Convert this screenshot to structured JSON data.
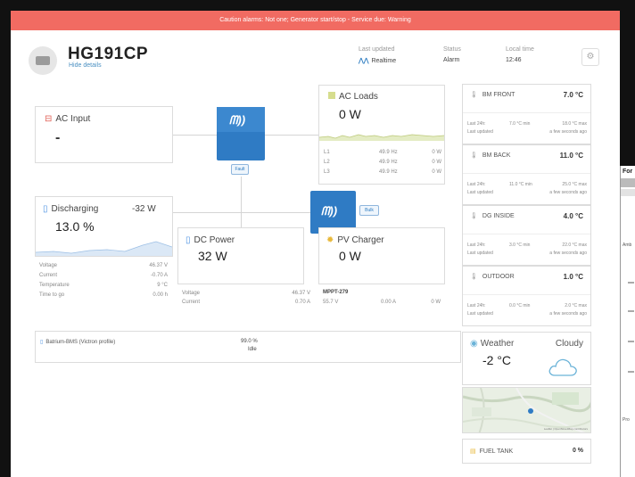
{
  "banner": {
    "text": "Caution alarms: Not one; Generator start/stop - Service due: Warning"
  },
  "header": {
    "device_name": "HG191CP",
    "hide_details": "Hide details",
    "last_updated_label": "Last updated",
    "last_updated_value": "Realtime",
    "status_label": "Status",
    "status_value": "Alarm",
    "local_time_label": "Local time",
    "local_time_value": "12:46"
  },
  "ac_input": {
    "title": "AC Input",
    "value": "-"
  },
  "inverter": {
    "badge": "Fault"
  },
  "ac_loads": {
    "title": "AC Loads",
    "value": "0 W",
    "phases": [
      {
        "label": "L1",
        "freq": "49.9 Hz",
        "power": "0 W"
      },
      {
        "label": "L2",
        "freq": "49.9 Hz",
        "power": "0 W"
      },
      {
        "label": "L3",
        "freq": "49.9 Hz",
        "power": "0 W"
      }
    ]
  },
  "battery": {
    "title": "Discharging",
    "current": "-32 W",
    "value": "13.0 %",
    "details": [
      {
        "label": "Voltage",
        "value": "46.37 V"
      },
      {
        "label": "Current",
        "value": "-0.70 A"
      },
      {
        "label": "Temperature",
        "value": "9 °C"
      },
      {
        "label": "Time to go",
        "value": "0.00 h"
      }
    ]
  },
  "dc_power": {
    "title": "DC Power",
    "value": "32 W",
    "details": [
      {
        "label": "Voltage",
        "value": "46.37 V"
      },
      {
        "label": "Current",
        "value": "0.70 A"
      }
    ]
  },
  "mppt": {
    "badge": "Bulk"
  },
  "pv_charger": {
    "title": "PV Charger",
    "value": "0 W",
    "model": "MPPT-279",
    "voltage": "55.7 V",
    "current": "0.00 A",
    "power": "0 W"
  },
  "bms": {
    "name": "Batrium-BMS (Victron profile)",
    "soc": "99.0 %",
    "state": "Idle"
  },
  "temperatures": [
    {
      "name": "BM FRONT",
      "value": "7.0 °C",
      "last24": "Last 24h:",
      "min": "7.0 °C min",
      "max": "18.0 °C max",
      "updated_label": "Last updated",
      "updated": "a few seconds ago"
    },
    {
      "name": "BM BACK",
      "value": "11.0 °C",
      "last24": "Last 24h:",
      "min": "11.0 °C min",
      "max": "25.0 °C max",
      "updated_label": "Last updated",
      "updated": "a few seconds ago"
    },
    {
      "name": "DG INSIDE",
      "value": "4.0 °C",
      "last24": "Last 24h:",
      "min": "3.0 °C min",
      "max": "22.0 °C max",
      "updated_label": "Last updated",
      "updated": "a few seconds ago"
    },
    {
      "name": "OUTDOOR",
      "value": "1.0 °C",
      "last24": "Last 24h:",
      "min": "0.0 °C min",
      "max": "2.0 °C max",
      "updated_label": "Last updated",
      "updated": "a few seconds ago"
    }
  ],
  "weather": {
    "title": "Weather",
    "condition": "Cloudy",
    "temp": "-2 °C"
  },
  "map": {
    "attribution": "Leaflet | OpenStreetMap contributors"
  },
  "fuel_tank": {
    "name": "FUEL TANK",
    "value": "0 %"
  },
  "side_panel": {
    "title": "For",
    "label1": "Amb",
    "label2": "Pro"
  },
  "colors": {
    "banner": "#f16b62",
    "victron_blue": "#2f7bc4",
    "accent": "#4a90c2"
  }
}
